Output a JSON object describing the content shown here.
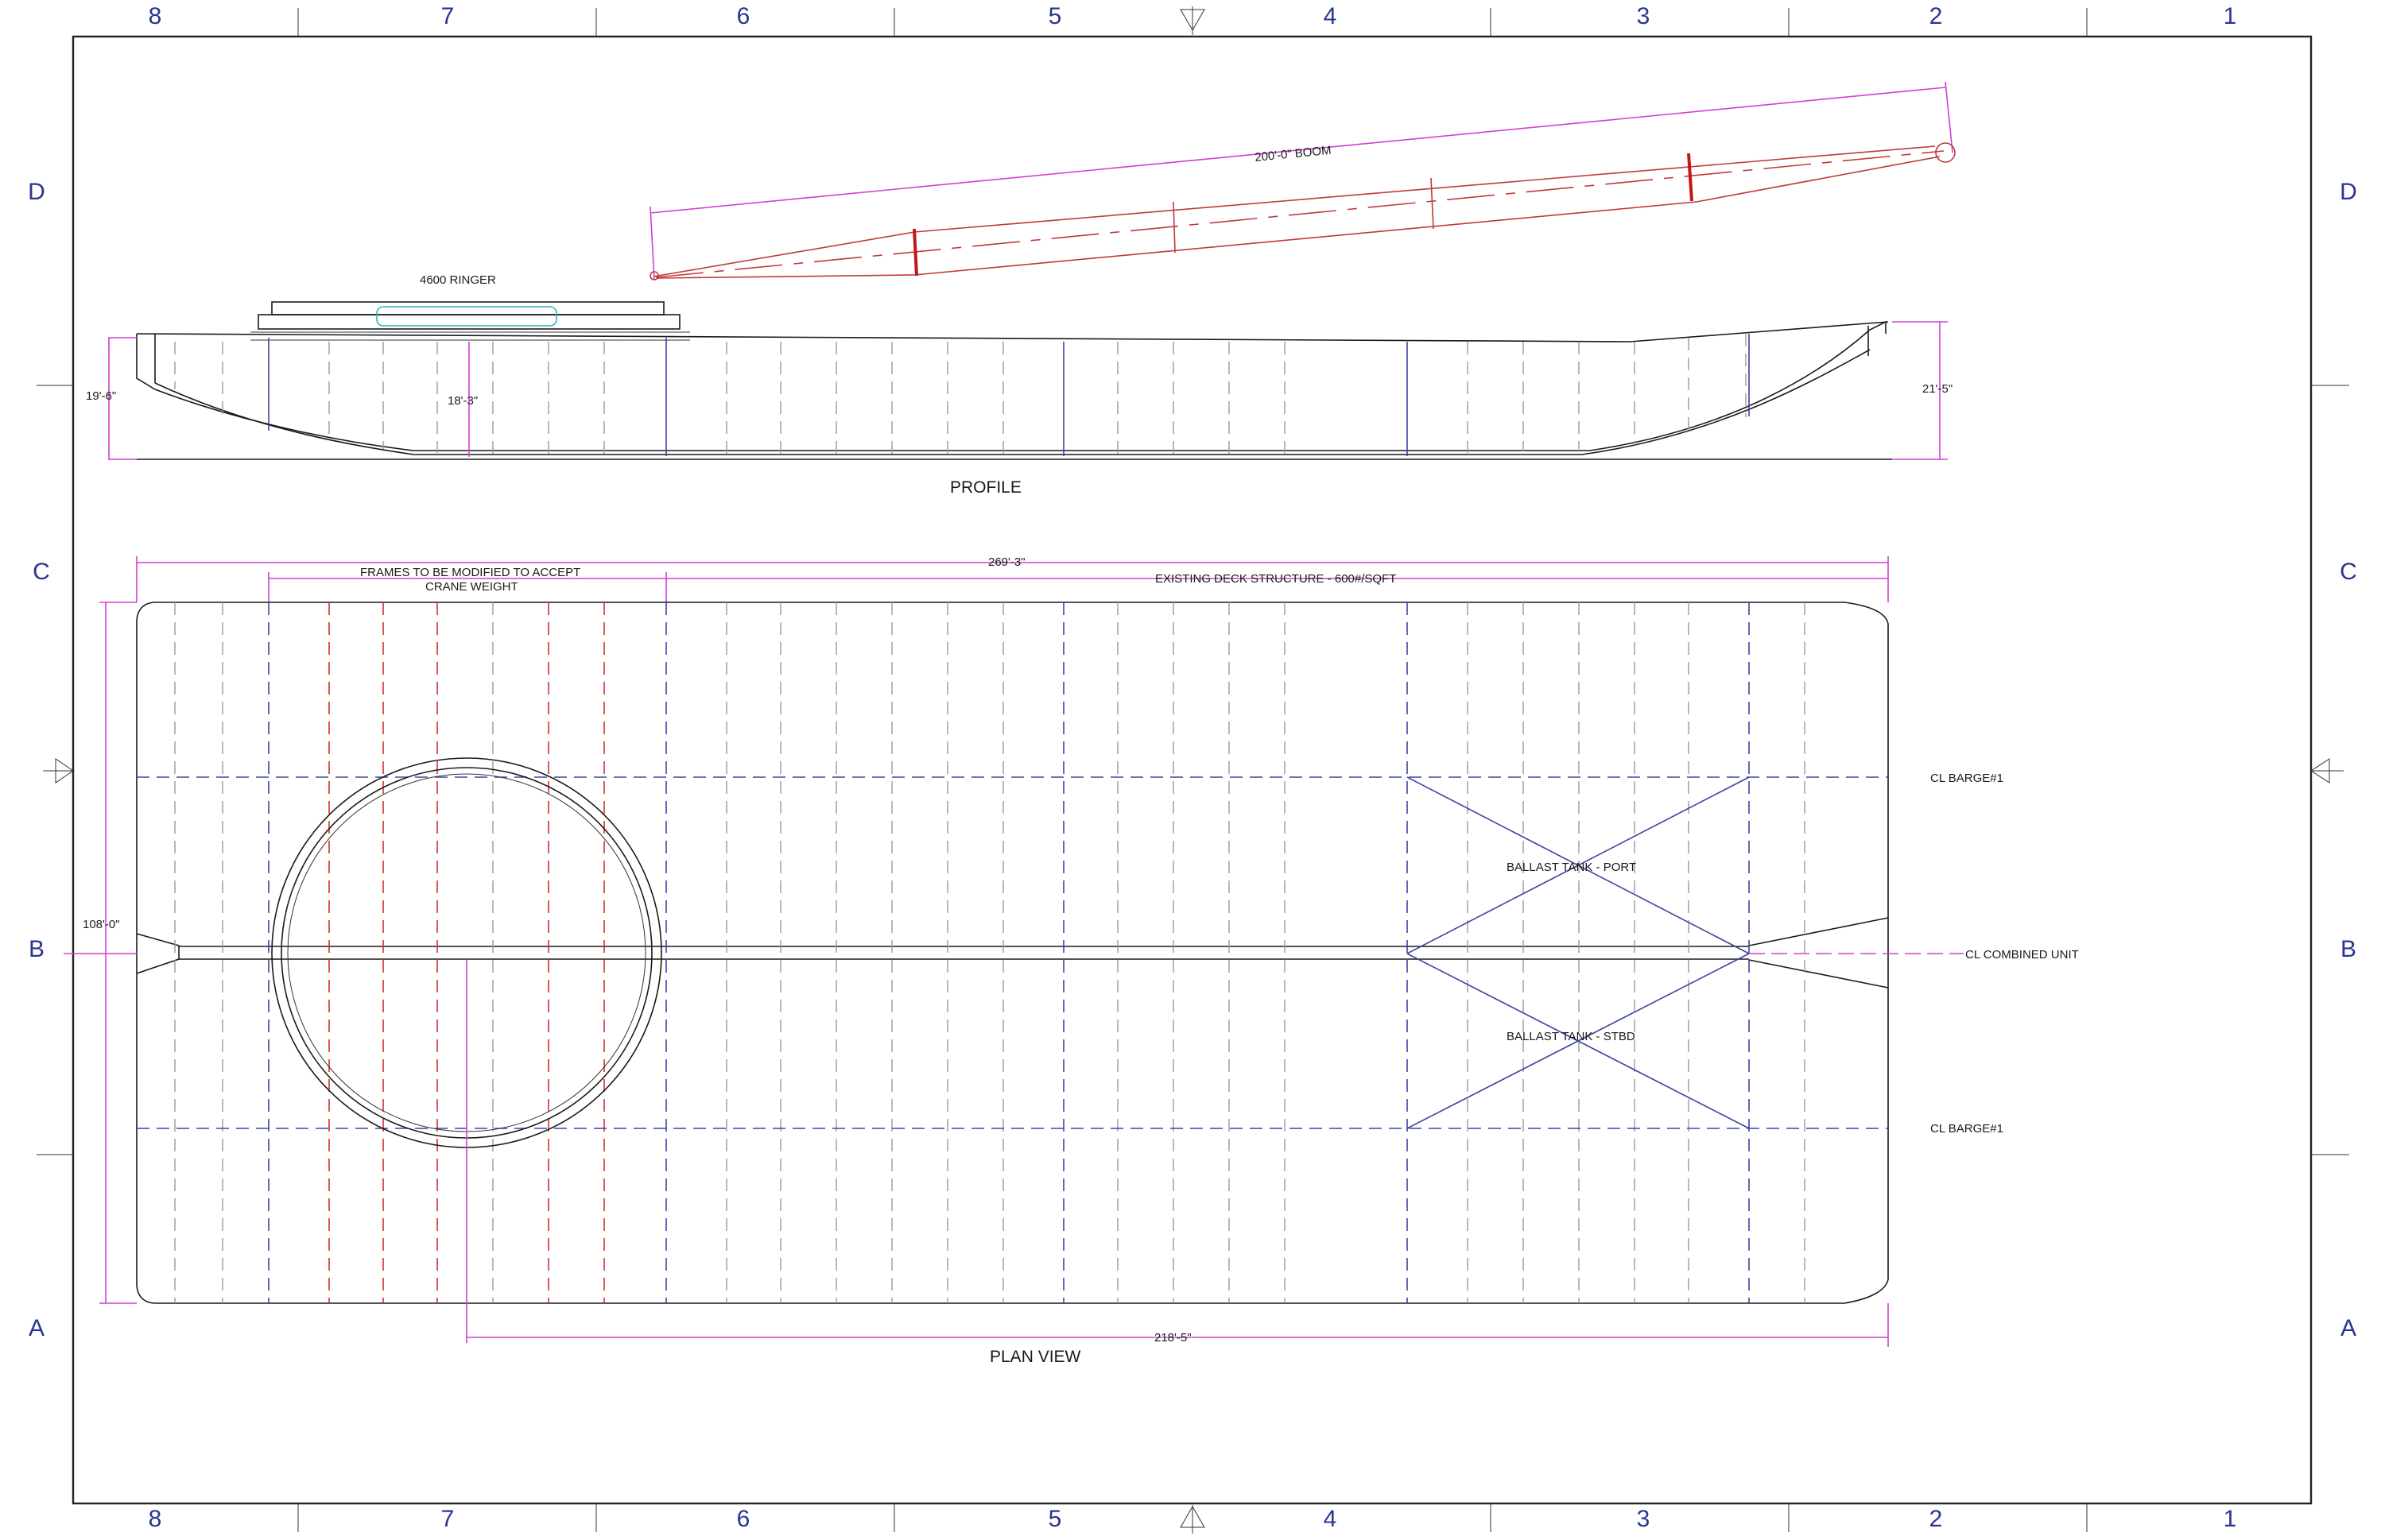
{
  "border": {
    "columns": [
      "8",
      "7",
      "6",
      "5",
      "4",
      "3",
      "2",
      "1"
    ],
    "rows": [
      "D",
      "C",
      "B",
      "A"
    ]
  },
  "profile": {
    "title": "PROFILE",
    "boom_label": "200'-0\" BOOM",
    "ringer_label": "4600 RINGER",
    "dim_left": "19'-6\"",
    "dim_mid": "18'-3\"",
    "dim_right": "21'-5\""
  },
  "plan": {
    "title": "PLAN VIEW",
    "dim_overall": "269'-3\"",
    "dim_frames_line1": "FRAMES TO BE MODIFIED TO ACCEPT",
    "dim_frames_line2": "CRANE WEIGHT",
    "dim_existing": "EXISTING DECK STRUCTURE - 600#/SQFT",
    "dim_width": "108'-0\"",
    "dim_bottom": "218'-5\"",
    "cl_barge_top": "CL BARGE#1",
    "cl_combined": "CL COMBINED UNIT",
    "cl_barge_bottom": "CL BARGE#1",
    "ballast_port": "BALLAST TANK - PORT",
    "ballast_stbd": "BALLAST TANK - STBD"
  },
  "colors": {
    "dimension": "#d040d0",
    "structure_blue": "#3a44a0",
    "modified_red": "#d03030",
    "outline": "#1a1a1a"
  }
}
